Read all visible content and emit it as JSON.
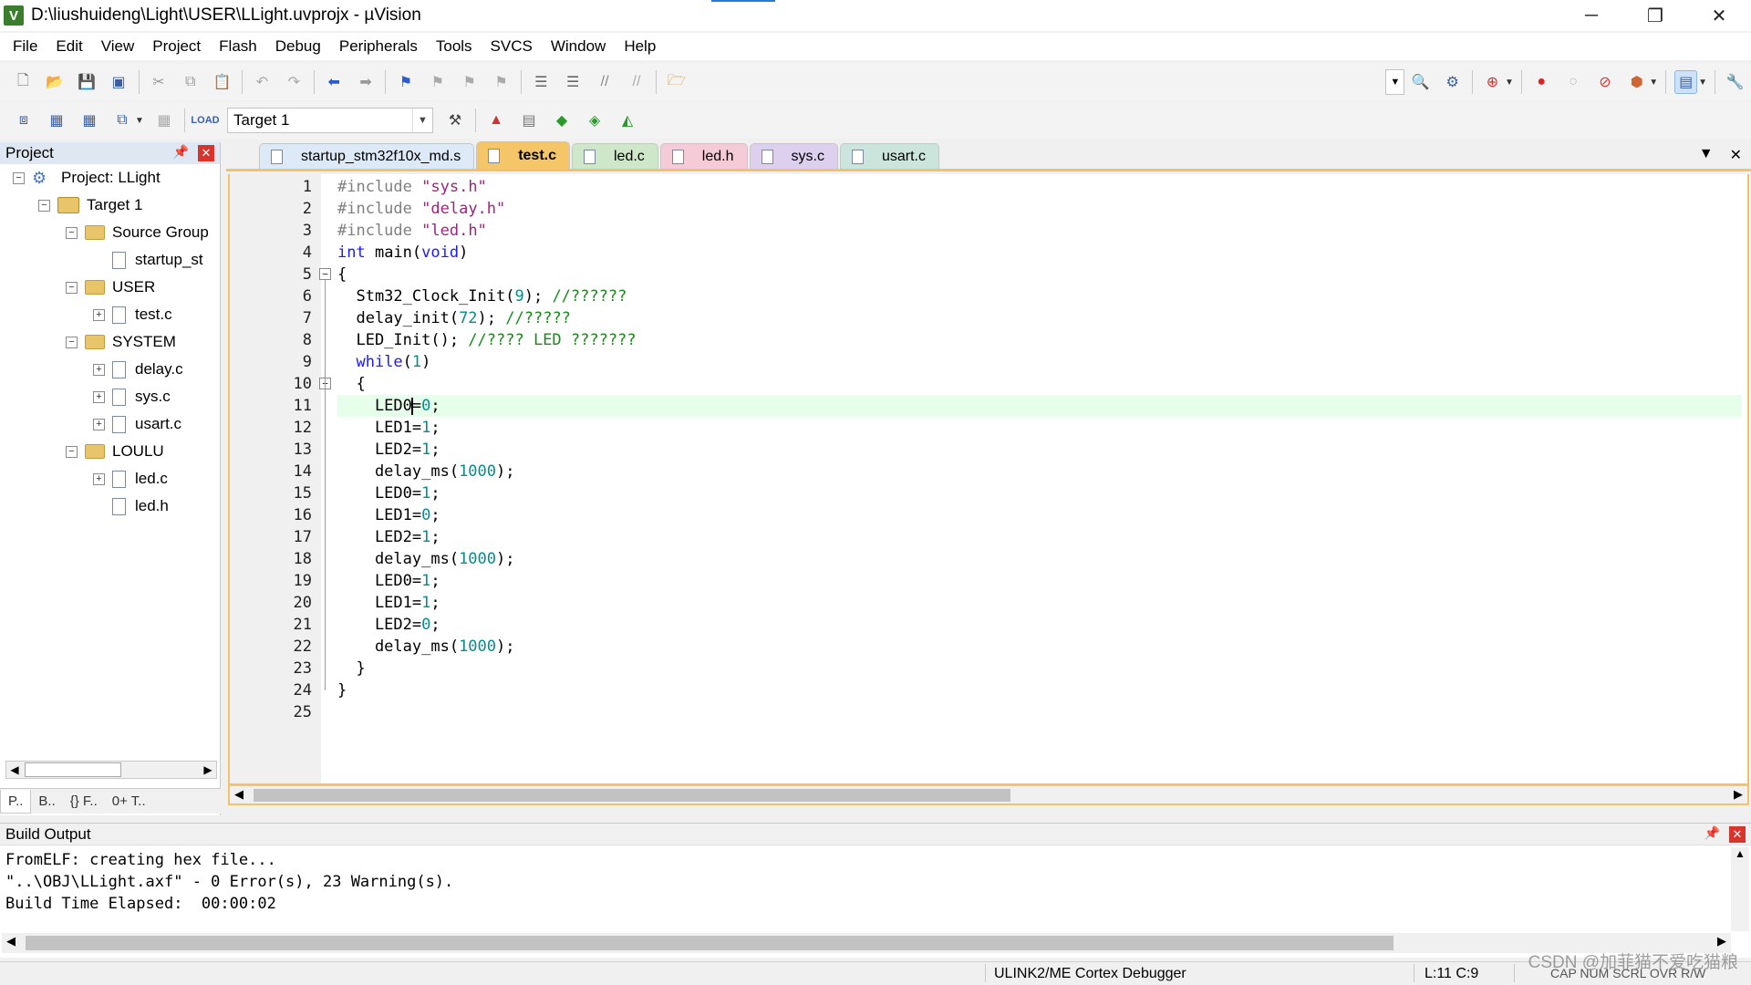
{
  "window": {
    "title": "D:\\liushuideng\\Light\\USER\\LLight.uvprojx - µVision",
    "app_icon": "uv-logo-icon",
    "controls": [
      "─",
      "❐",
      "✕"
    ]
  },
  "menu": [
    "File",
    "Edit",
    "View",
    "Project",
    "Flash",
    "Debug",
    "Peripherals",
    "Tools",
    "SVCS",
    "Window",
    "Help"
  ],
  "toolbar2": {
    "target_label": "Target 1"
  },
  "project_panel": {
    "title": "Project",
    "tree": [
      {
        "label": "Project: LLight",
        "level": 0,
        "type": "project",
        "toggle": "−"
      },
      {
        "label": "Target 1",
        "level": 1,
        "type": "target",
        "toggle": "−"
      },
      {
        "label": "Source Group",
        "level": 2,
        "type": "folder",
        "toggle": "−"
      },
      {
        "label": "startup_st",
        "level": 3,
        "type": "file",
        "toggle": ""
      },
      {
        "label": "USER",
        "level": 2,
        "type": "folder",
        "toggle": "−"
      },
      {
        "label": "test.c",
        "level": 3,
        "type": "file",
        "toggle": "+"
      },
      {
        "label": "SYSTEM",
        "level": 2,
        "type": "folder",
        "toggle": "−"
      },
      {
        "label": "delay.c",
        "level": 3,
        "type": "file",
        "toggle": "+"
      },
      {
        "label": "sys.c",
        "level": 3,
        "type": "file",
        "toggle": "+"
      },
      {
        "label": "usart.c",
        "level": 3,
        "type": "file",
        "toggle": "+"
      },
      {
        "label": "LOULU",
        "level": 2,
        "type": "folder",
        "toggle": "−"
      },
      {
        "label": "led.c",
        "level": 3,
        "type": "file",
        "toggle": "+"
      },
      {
        "label": "led.h",
        "level": 3,
        "type": "file",
        "toggle": ""
      }
    ],
    "tabs": [
      "P..",
      "B..",
      "{} F..",
      "0+ T.."
    ]
  },
  "editor": {
    "tabs": [
      {
        "label": "startup_stm32f10x_md.s",
        "color": "#dde9f7",
        "active": false
      },
      {
        "label": "test.c",
        "color": "#f5c667",
        "active": true
      },
      {
        "label": "led.c",
        "color": "#cfe7c9",
        "active": false
      },
      {
        "label": "led.h",
        "color": "#f4cbd7",
        "active": false
      },
      {
        "label": "sys.c",
        "color": "#ddd0ef",
        "active": false
      },
      {
        "label": "usart.c",
        "color": "#cbe4dc",
        "active": false
      }
    ],
    "current_line": 11,
    "lines": [
      "#include \"sys.h\"",
      "#include \"delay.h\"",
      "#include \"led.h\"",
      "int main(void)",
      "{",
      "  Stm32_Clock_Init(9); //??????",
      "  delay_init(72); //?????",
      "  LED_Init(); //???? LED ???????",
      "  while(1)",
      "  {",
      "    LED0=0;",
      "    LED1=1;",
      "    LED2=1;",
      "    delay_ms(1000);",
      "    LED0=1;",
      "    LED1=0;",
      "    LED2=1;",
      "    delay_ms(1000);",
      "    LED0=1;",
      "    LED1=1;",
      "    LED2=0;",
      "    delay_ms(1000);",
      "  }",
      "}",
      ""
    ]
  },
  "build_output": {
    "title": "Build Output",
    "lines": [
      "FromELF: creating hex file...",
      "\"..\\OBJ\\LLight.axf\" - 0 Error(s), 23 Warning(s).",
      "Build Time Elapsed:  00:00:02"
    ]
  },
  "status": {
    "debugger": "ULINK2/ME Cortex Debugger",
    "position": "L:11 C:9",
    "flags": "CAP  NUM  SCRL  OVR  R/W"
  },
  "watermark": "CSDN @加菲猫不爱吃猫粮",
  "colors": {
    "editor_border": "#f2c26b",
    "keyword": "#1a1aff",
    "preprocessor": "#808080",
    "string": "#a0237f",
    "number": "#0a8a8a",
    "comment": "#1a8a1a",
    "current_line_bg": "#e6ffea"
  }
}
